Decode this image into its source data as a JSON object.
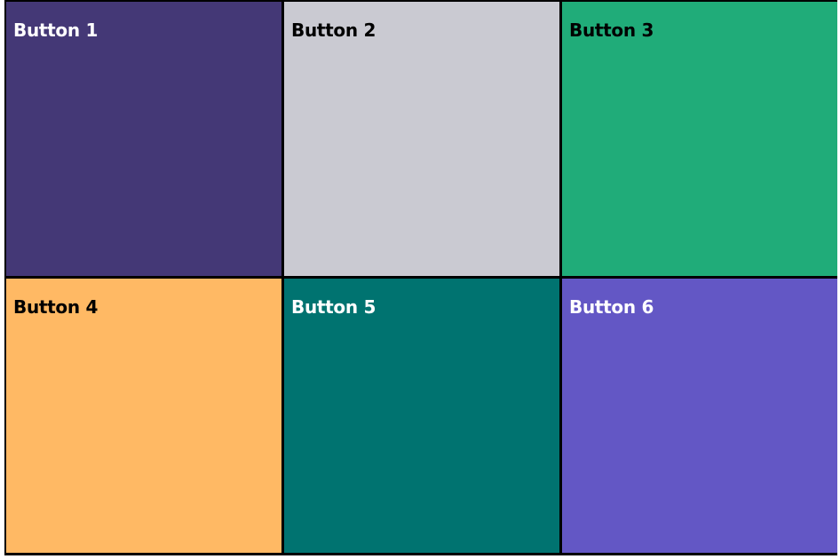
{
  "buttons": [
    {
      "label": "Button 1",
      "bg": "#443876",
      "fg": "#ffffff"
    },
    {
      "label": "Button 2",
      "bg": "#cacad2",
      "fg": "#000000"
    },
    {
      "label": "Button 3",
      "bg": "#20ac79",
      "fg": "#000000"
    },
    {
      "label": "Button 4",
      "bg": "#ffb964",
      "fg": "#000000"
    },
    {
      "label": "Button 5",
      "bg": "#007370",
      "fg": "#ffffff"
    },
    {
      "label": "Button 6",
      "bg": "#6357c5",
      "fg": "#ffffff"
    }
  ]
}
